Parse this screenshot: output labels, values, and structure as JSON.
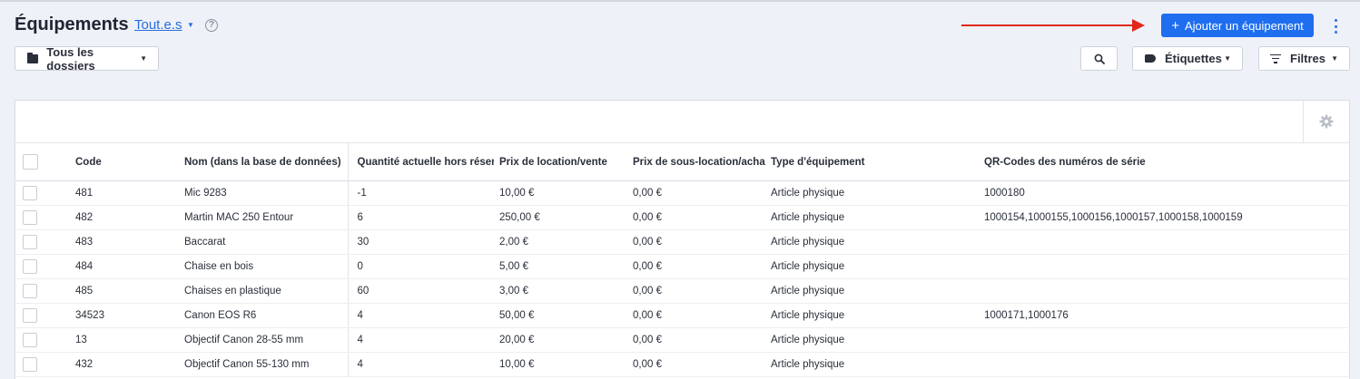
{
  "header": {
    "title": "Équipements",
    "filter_link": "Tout.e.s",
    "help_glyph": "?",
    "add_button": "Ajouter un équipement",
    "add_plus": "+"
  },
  "toolbar": {
    "folders_label": "Tous les dossiers",
    "tags_label": "Étiquettes",
    "filters_label": "Filtres",
    "caret": "▼"
  },
  "icons": {
    "search": "search-icon",
    "gear": "gear-icon",
    "folder": "folder-icon",
    "tag": "tag-icon",
    "filter": "filter-icon",
    "more": "more-vertical-icon"
  },
  "colors": {
    "primary": "#1f6ef0",
    "arrow": "#e0281a",
    "link": "#2a6de0"
  },
  "table": {
    "columns": [
      "Code",
      "Nom (dans la base de données)",
      "Quantité actuelle hors réservation",
      "Prix de location/vente",
      "Prix de sous-location/achat",
      "Type d'équipement",
      "QR-Codes des numéros de série"
    ],
    "rows": [
      {
        "code": "481",
        "name": "Mic 9283",
        "qty": "-1",
        "rent": "10,00 €",
        "buy": "0,00 €",
        "type": "Article physique",
        "qr": "1000180"
      },
      {
        "code": "482",
        "name": "Martin MAC 250 Entour",
        "qty": "6",
        "rent": "250,00 €",
        "buy": "0,00 €",
        "type": "Article physique",
        "qr": "1000154,1000155,1000156,1000157,1000158,1000159"
      },
      {
        "code": "483",
        "name": "Baccarat",
        "qty": "30",
        "rent": "2,00 €",
        "buy": "0,00 €",
        "type": "Article physique",
        "qr": ""
      },
      {
        "code": "484",
        "name": "Chaise en bois",
        "qty": "0",
        "rent": "5,00 €",
        "buy": "0,00 €",
        "type": "Article physique",
        "qr": ""
      },
      {
        "code": "485",
        "name": "Chaises en plastique",
        "qty": "60",
        "rent": "3,00 €",
        "buy": "0,00 €",
        "type": "Article physique",
        "qr": ""
      },
      {
        "code": "34523",
        "name": "Canon EOS R6",
        "qty": "4",
        "rent": "50,00 €",
        "buy": "0,00 €",
        "type": "Article physique",
        "qr": "1000171,1000176"
      },
      {
        "code": "13",
        "name": "Objectif Canon 28-55 mm",
        "qty": "4",
        "rent": "20,00 €",
        "buy": "0,00 €",
        "type": "Article physique",
        "qr": ""
      },
      {
        "code": "432",
        "name": "Objectif Canon 55-130 mm",
        "qty": "4",
        "rent": "10,00 €",
        "buy": "0,00 €",
        "type": "Article physique",
        "qr": ""
      }
    ]
  }
}
